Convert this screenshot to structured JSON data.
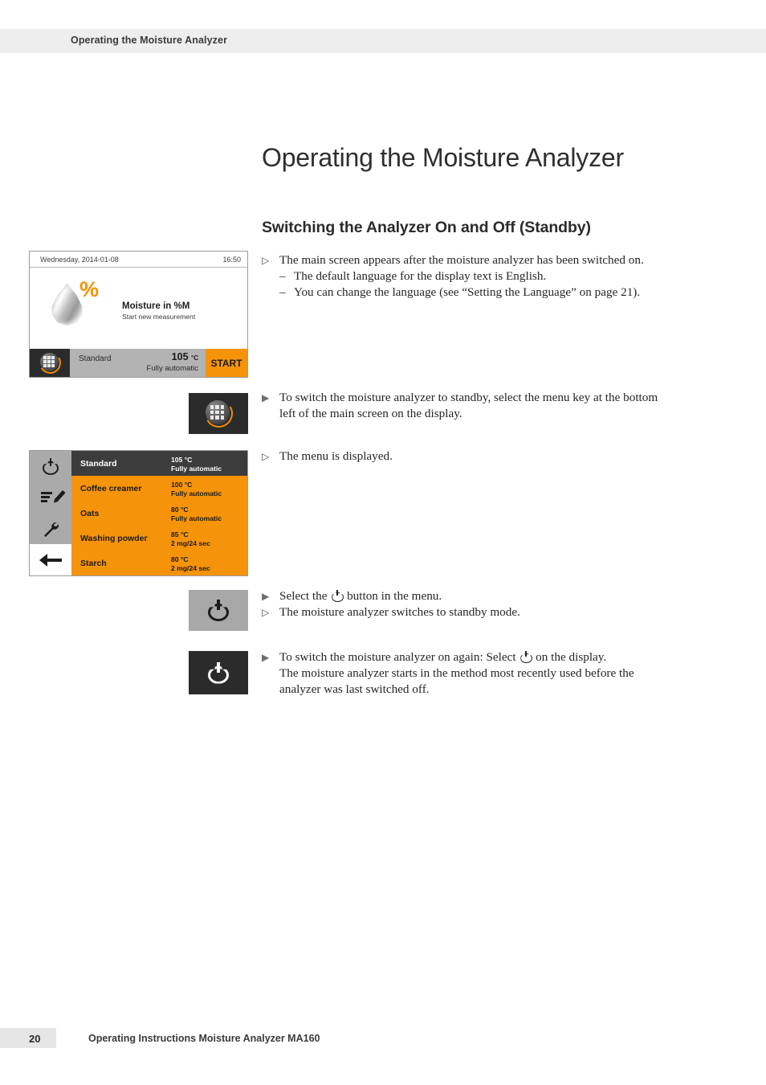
{
  "running_header": "Operating the Moisture Analyzer",
  "chapter_title": "Operating the Moisture Analyzer",
  "section_title": "Switching the Analyzer On and Off (Standby)",
  "main_screen": {
    "date": "Wednesday, 2014-01-08",
    "time": "16:50",
    "percent_glyph": "%",
    "headline": "Moisture in %M",
    "subline": "Start new measurement",
    "method_name": "Standard",
    "temperature": "105",
    "temperature_unit": "°C",
    "mode": "Fully automatic",
    "start_label": "START"
  },
  "menu_screen": {
    "sidebar": [
      {
        "icon": "power-icon"
      },
      {
        "icon": "edit-icon"
      },
      {
        "icon": "wrench-icon"
      },
      {
        "icon": "back-arrow-icon"
      }
    ],
    "rows": [
      {
        "name": "Standard",
        "temp": "105 °C",
        "mode": "Fully automatic",
        "selected": true
      },
      {
        "name": "Coffee creamer",
        "temp": "100 °C",
        "mode": "Fully automatic",
        "selected": false
      },
      {
        "name": "Oats",
        "temp": "80 °C",
        "mode": "Fully automatic",
        "selected": false
      },
      {
        "name": "Washing powder",
        "temp": "85 °C",
        "mode": "2 mg/24 sec",
        "selected": false
      },
      {
        "name": "Starch",
        "temp": "80 °C",
        "mode": "2 mg/24 sec",
        "selected": false
      }
    ]
  },
  "steps": {
    "s1_result": "The main screen appears after the moisture analyzer has been switched on.",
    "s1_sub1": "The default language for the display text is English.",
    "s1_sub2": "You can change the language (see “Setting the Language” on page 21).",
    "s2_action_line1": "To switch the moisture analyzer to standby, select the menu key at the bottom",
    "s2_action_line2": "left of the main screen on the display.",
    "s3_result": "The menu is displayed.",
    "s4_action_pre": "Select the",
    "s4_action_post": "button in the menu.",
    "s4_result": "The moisture analyzer switches to standby mode.",
    "s5_action_pre": "To switch the moisture analyzer on again: Select",
    "s5_action_post": "on the display.",
    "s5_line2": "The moisture analyzer starts in the method most recently used before the",
    "s5_line3": "analyzer was last switched off."
  },
  "markers": {
    "solid": "▶",
    "hollow": "▷",
    "dash": "–"
  },
  "footer": {
    "page_number": "20",
    "text": "Operating Instructions Moisture Analyzer MA160"
  },
  "colors": {
    "orange": "#f5930a",
    "percent_orange": "#f29400",
    "dark": "#2b2b2b",
    "header_gray": "#eeeeee"
  }
}
